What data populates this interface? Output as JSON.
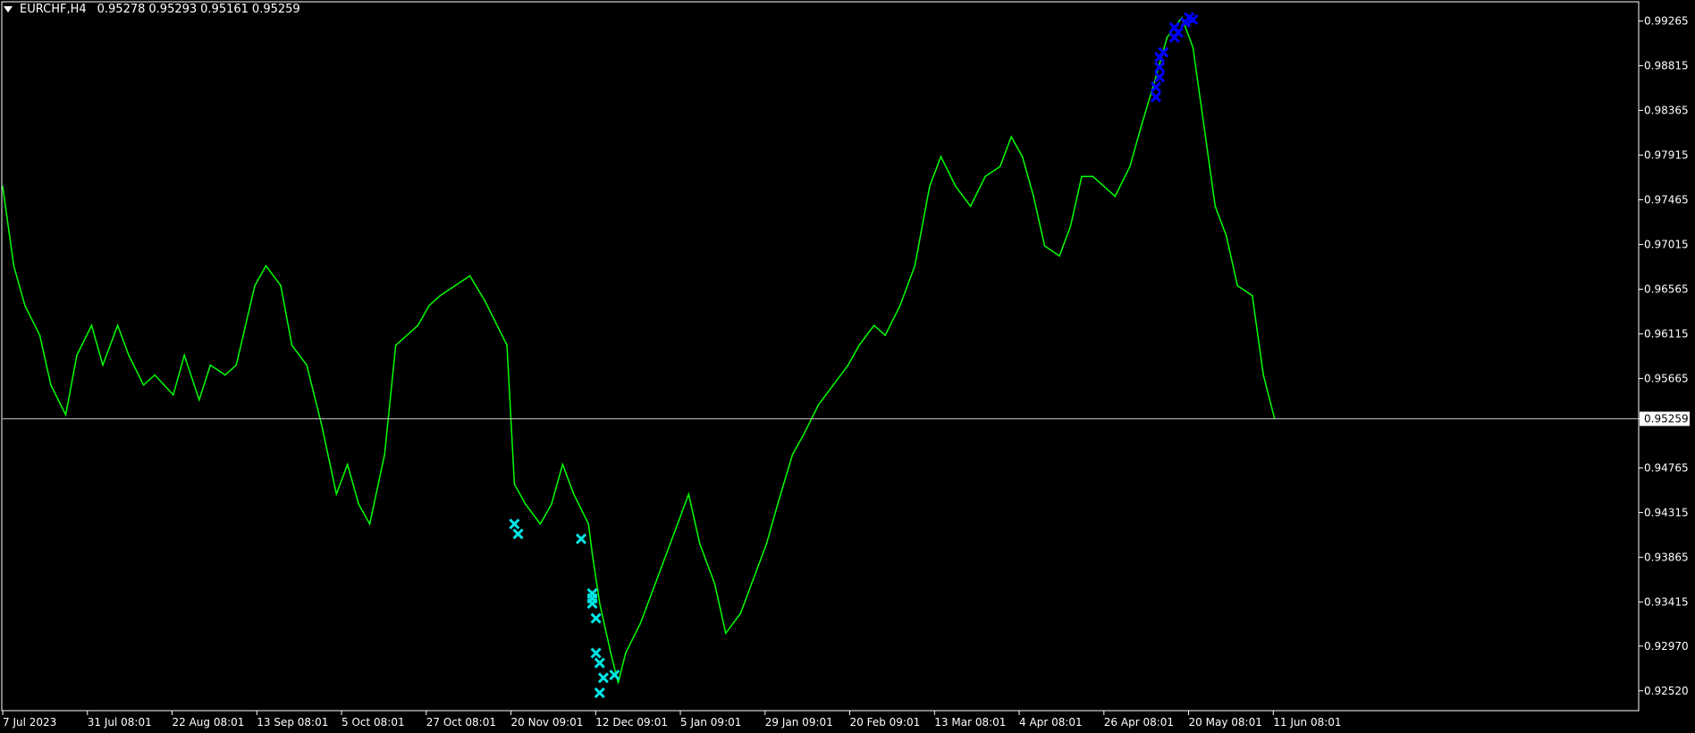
{
  "header": {
    "symbol": "EURCHF,H4",
    "open": "0.95278",
    "high": "0.95293",
    "low": "0.95161",
    "close": "0.95259"
  },
  "colors": {
    "background": "#000000",
    "frame": "#ffffff",
    "line": "#00ff00",
    "buy_marker": "#00e5e5",
    "sell_marker": "#0000ff",
    "price_line": "#c0c0c0",
    "text": "#ffffff"
  },
  "chart_data": {
    "type": "line",
    "title": "EURCHF,H4",
    "grid": false,
    "ylim": [
      0.9232,
      0.9945
    ],
    "y_ticks": [
      "0.99265",
      "0.98815",
      "0.98365",
      "0.97915",
      "0.97465",
      "0.97015",
      "0.96565",
      "0.96115",
      "0.95665",
      "0.95259",
      "0.94765",
      "0.94315",
      "0.93865",
      "0.93415",
      "0.92970",
      "0.92520"
    ],
    "x_ticks": [
      "7 Jul 2023",
      "31 Jul 08:01",
      "22 Aug 08:01",
      "13 Sep 08:01",
      "5 Oct 08:01",
      "27 Oct 08:01",
      "20 Nov 09:01",
      "12 Dec 09:01",
      "5 Jan 09:01",
      "29 Jan 09:01",
      "20 Feb 09:01",
      "13 Mar 08:01",
      "4 Apr 08:01",
      "26 Apr 08:01",
      "20 May 08:01",
      "11 Jun 08:01"
    ],
    "current_price": 0.95259,
    "x_range_days": [
      0,
      352
    ],
    "series": [
      {
        "x": [
          "7 Jul 2023",
          "10 Jul",
          "13 Jul",
          "17 Jul",
          "20 Jul",
          "24 Jul",
          "27 Jul",
          "31 Jul",
          "3 Aug",
          "7 Aug",
          "10 Aug",
          "14 Aug",
          "17 Aug",
          "22 Aug",
          "25 Aug",
          "29 Aug",
          "1 Sep",
          "5 Sep",
          "8 Sep",
          "13 Sep",
          "16 Sep",
          "20 Sep",
          "23 Sep",
          "27 Sep",
          "1 Oct",
          "5 Oct",
          "8 Oct",
          "11 Oct",
          "14 Oct",
          "18 Oct",
          "21 Oct",
          "27 Oct",
          "30 Oct",
          "2 Nov",
          "6 Nov",
          "10 Nov",
          "14 Nov",
          "20 Nov",
          "22 Nov",
          "25 Nov",
          "29 Nov",
          "2 Dec",
          "5 Dec",
          "8 Dec",
          "12 Dec",
          "13 Dec",
          "15 Dec",
          "18 Dec",
          "20 Dec",
          "22 Dec",
          "26 Dec",
          "29 Dec",
          "5 Jan",
          "8 Jan",
          "11 Jan",
          "15 Jan",
          "18 Jan",
          "22 Jan",
          "25 Jan",
          "29 Jan",
          "1 Feb",
          "5 Feb",
          "8 Feb",
          "12 Feb",
          "16 Feb",
          "20 Feb",
          "23 Feb",
          "27 Feb",
          "1 Mar",
          "5 Mar",
          "9 Mar",
          "13 Mar",
          "16 Mar",
          "20 Mar",
          "24 Mar",
          "28 Mar",
          "1 Apr",
          "4 Apr",
          "7 Apr",
          "10 Apr",
          "13 Apr",
          "17 Apr",
          "20 Apr",
          "23 Apr",
          "26 Apr",
          "29 Apr",
          "2 May",
          "6 May",
          "9 May",
          "13 May",
          "16 May",
          "20 May",
          "23 May",
          "26 May",
          "29 May",
          "1 Jun",
          "4 Jun",
          "8 Jun",
          "11 Jun",
          "14 Jun"
        ],
        "y": [
          0.976,
          0.968,
          0.964,
          0.961,
          0.956,
          0.953,
          0.959,
          0.962,
          0.958,
          0.962,
          0.959,
          0.956,
          0.957,
          0.955,
          0.959,
          0.9545,
          0.958,
          0.957,
          0.958,
          0.966,
          0.968,
          0.966,
          0.96,
          0.958,
          0.952,
          0.945,
          0.948,
          0.944,
          0.942,
          0.949,
          0.96,
          0.962,
          0.964,
          0.965,
          0.966,
          0.967,
          0.9645,
          0.96,
          0.946,
          0.944,
          0.942,
          0.944,
          0.948,
          0.945,
          0.942,
          0.939,
          0.934,
          0.929,
          0.926,
          0.929,
          0.932,
          0.935,
          0.942,
          0.945,
          0.94,
          0.936,
          0.931,
          0.933,
          0.936,
          0.94,
          0.944,
          0.949,
          0.951,
          0.954,
          0.956,
          0.958,
          0.96,
          0.962,
          0.961,
          0.964,
          0.968,
          0.976,
          0.979,
          0.976,
          0.974,
          0.977,
          0.978,
          0.981,
          0.979,
          0.975,
          0.97,
          0.969,
          0.972,
          0.977,
          0.977,
          0.976,
          0.975,
          0.978,
          0.982,
          0.987,
          0.991,
          0.993,
          0.99,
          0.982,
          0.974,
          0.971,
          0.966,
          0.965,
          0.957,
          0.9526
        ]
      }
    ],
    "buy_markers": [
      {
        "x": "22 Nov",
        "y": 0.942
      },
      {
        "x": "23 Nov",
        "y": 0.941
      },
      {
        "x": "10 Dec",
        "y": 0.9405
      },
      {
        "x": "13 Dec",
        "y": 0.935
      },
      {
        "x": "13 Dec",
        "y": 0.934
      },
      {
        "x": "13 Dec",
        "y": 0.9345
      },
      {
        "x": "14 Dec",
        "y": 0.9325
      },
      {
        "x": "14 Dec",
        "y": 0.929
      },
      {
        "x": "15 Dec",
        "y": 0.928
      },
      {
        "x": "16 Dec",
        "y": 0.9265
      },
      {
        "x": "19 Dec",
        "y": 0.9268
      },
      {
        "x": "15 Dec",
        "y": 0.925
      }
    ],
    "sell_markers": [
      {
        "x": "13 May",
        "y": 0.985
      },
      {
        "x": "13 May",
        "y": 0.986
      },
      {
        "x": "14 May",
        "y": 0.987
      },
      {
        "x": "14 May",
        "y": 0.988
      },
      {
        "x": "14 May",
        "y": 0.989
      },
      {
        "x": "15 May",
        "y": 0.9895
      },
      {
        "x": "18 May",
        "y": 0.991
      },
      {
        "x": "18 May",
        "y": 0.992
      },
      {
        "x": "19 May",
        "y": 0.9915
      },
      {
        "x": "21 May",
        "y": 0.9925
      },
      {
        "x": "22 May",
        "y": 0.993
      },
      {
        "x": "23 May",
        "y": 0.9928
      }
    ]
  }
}
